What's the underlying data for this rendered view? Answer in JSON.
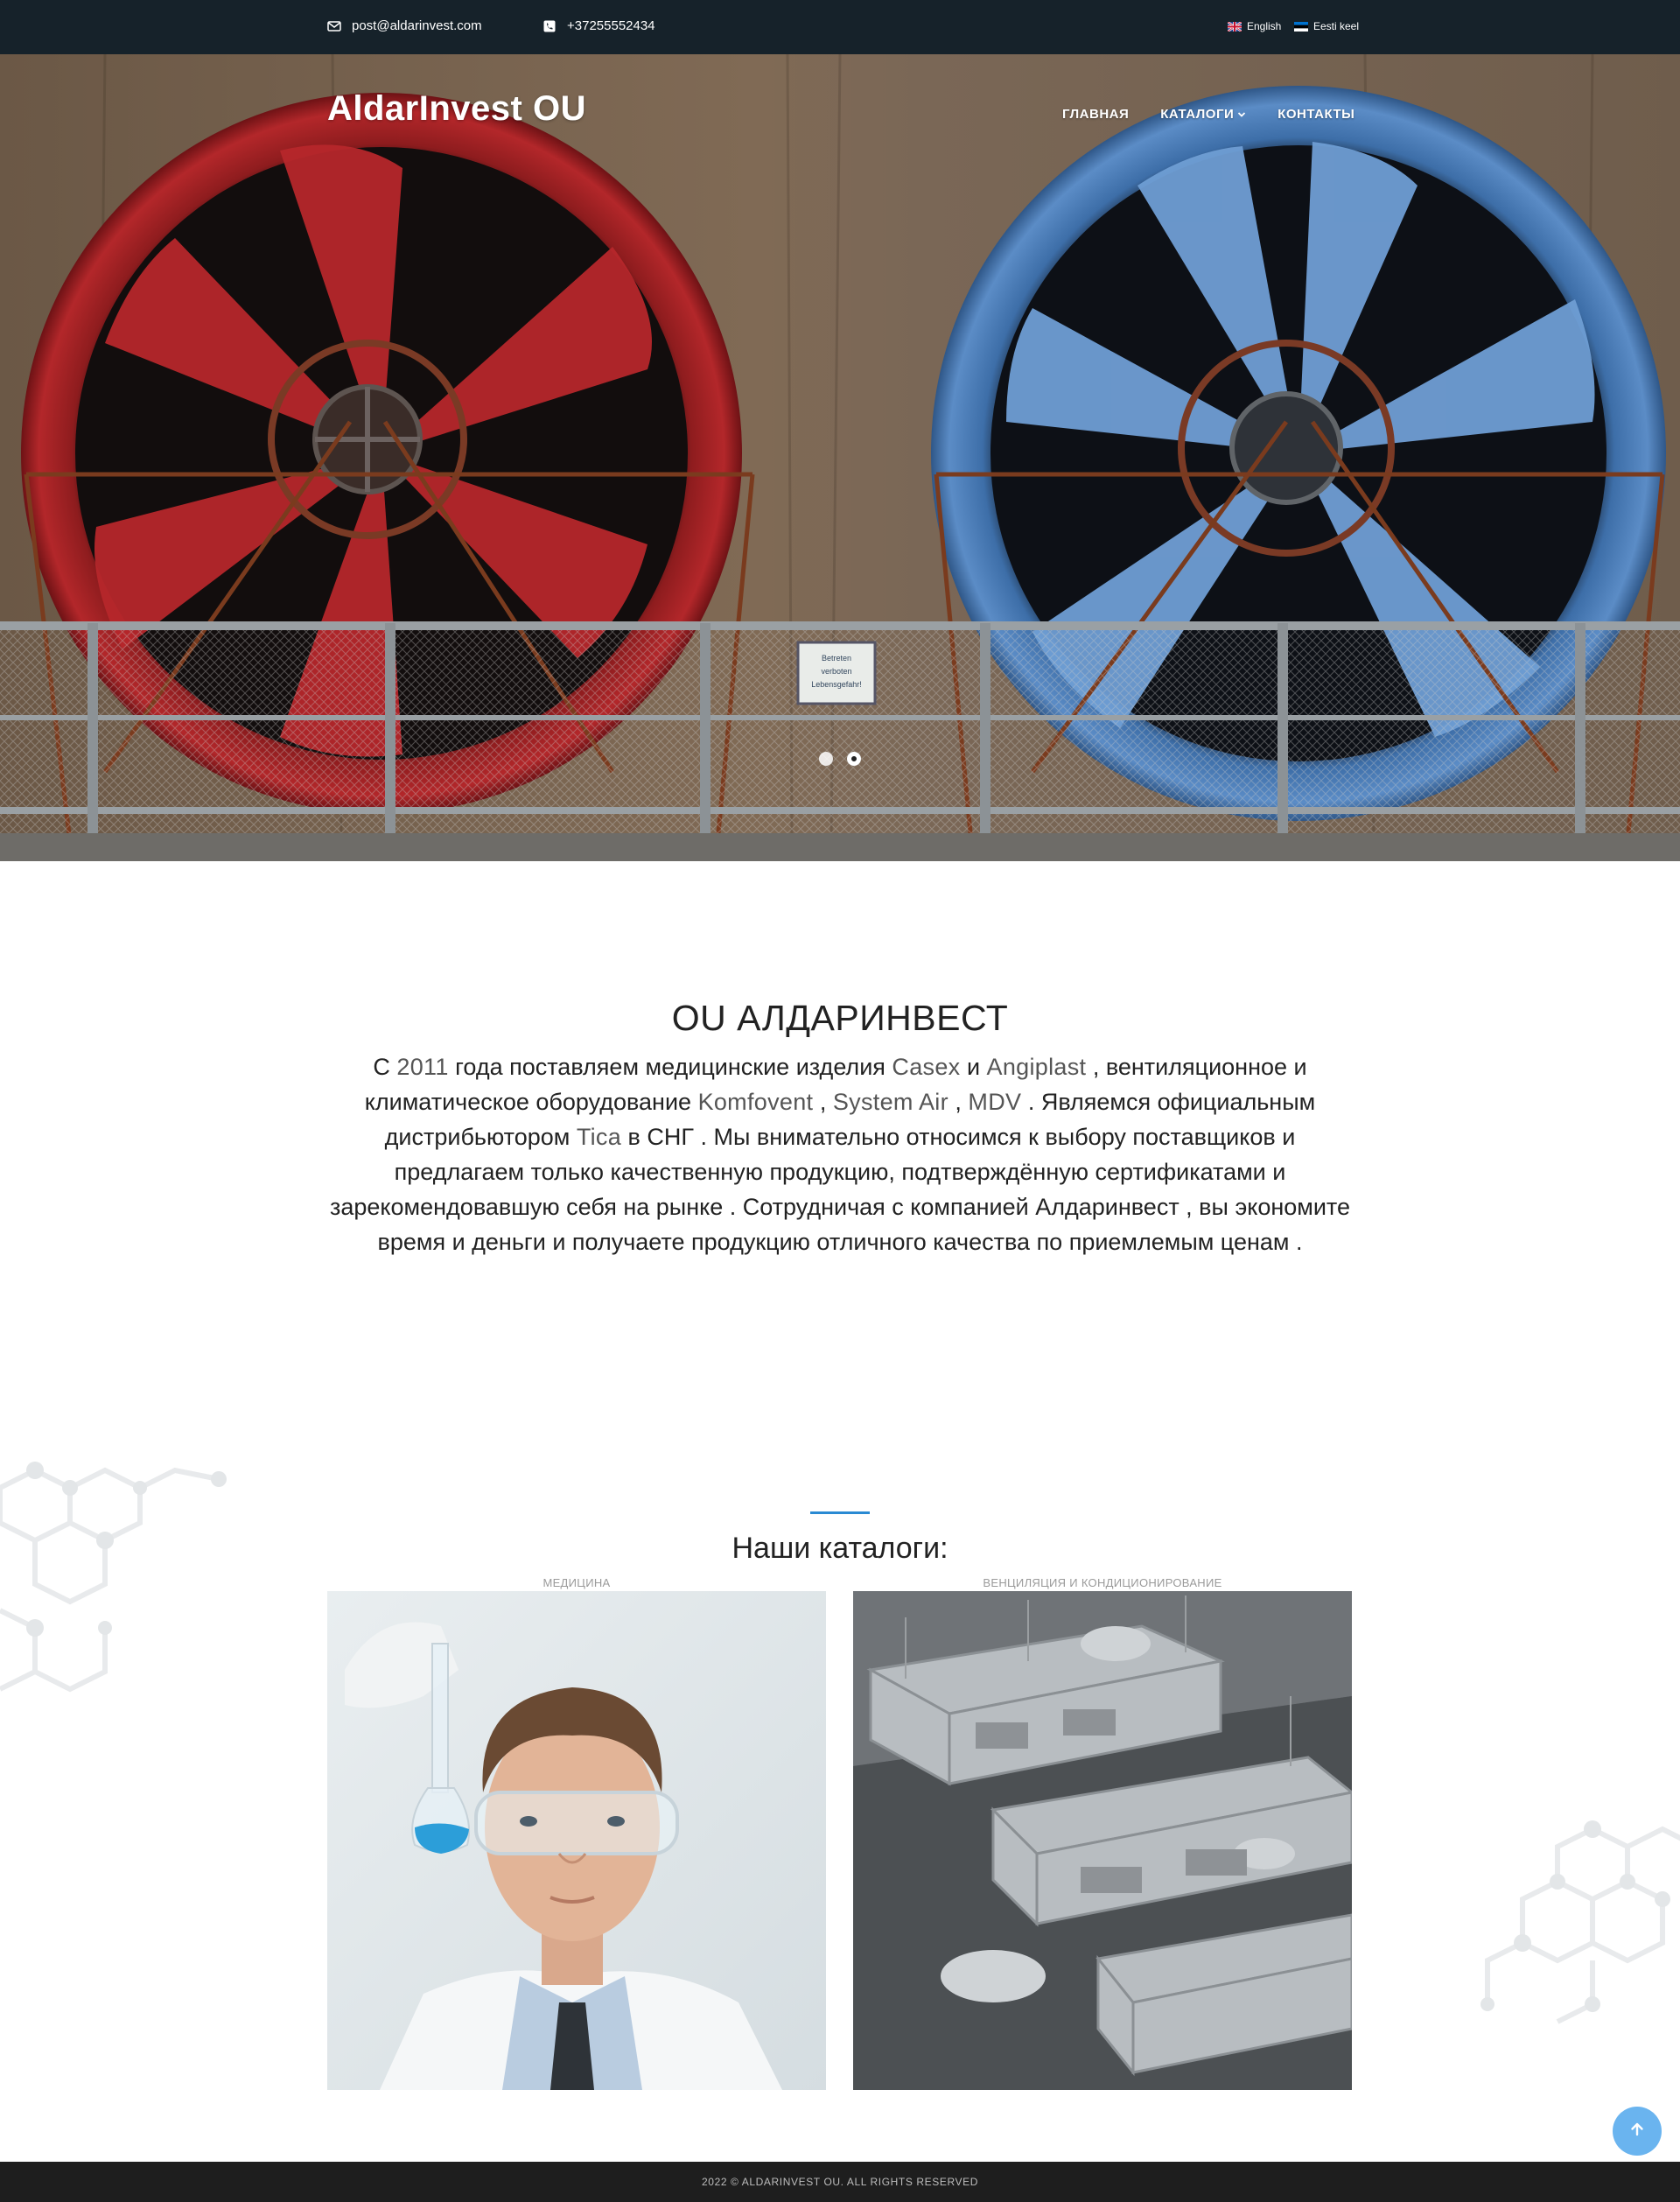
{
  "topbar": {
    "email": "post@aldarinvest.com",
    "phone": "+37255552434",
    "languages": [
      {
        "label": "English",
        "icon": "uk-flag-icon"
      },
      {
        "label": "Eesti keel",
        "icon": "estonia-flag-icon"
      }
    ]
  },
  "header": {
    "brand": "AldarInvest OU",
    "nav": [
      {
        "label": "ГЛАВНАЯ"
      },
      {
        "label": "КАТАЛОГИ",
        "has_dropdown": true
      },
      {
        "label": "КОНТАКТЫ"
      }
    ]
  },
  "hero": {
    "sign": [
      "Betreten",
      "verboten",
      "Lebensgefahr!"
    ],
    "slides": 2,
    "active_slide": 1
  },
  "about": {
    "title": "OU АЛДАРИНВЕСТ",
    "p1": "С ",
    "year": "2011",
    "p2": " года поставляем медицинские изделия ",
    "brand1": "Casex",
    "p3": "  и ",
    "brand2": "Angiplast",
    "p4": " , вентиляционное  и климатическое оборудование ",
    "brand3": "Komfovent",
    "p5": " , ",
    "brand4": "System Air",
    "p6": " ,  ",
    "brand5": "MDV",
    "p7": " . Являемся официальным дистрибьютором ",
    "brand6": "Tica",
    "p8": " в СНГ . Мы внимательно относимся к выбору поставщиков и предлагаем только качественную продукцию, подтверждённую сертификатами и зарекомендовавшую себя на рынке . Сотрудничая с компанией Алдаринвест , вы экономите время и деньги и получаете продукцию отличного качества по приемлемым ценам ."
  },
  "catalogs": {
    "title": "Наши каталоги:",
    "items": [
      {
        "label": "МЕДИЦИНА"
      },
      {
        "label": "ВЕНЦИЛЯЦИЯ И КОНДИЦИОНИРОВАНИЕ"
      }
    ]
  },
  "footer": {
    "text": "2022 © ALDARINVEST OU. ALL RIGHTS RESERVED"
  },
  "colors": {
    "topbar": "#16222a",
    "accent": "#2a8ad3",
    "scroll_button": "#6ab4ef",
    "footer": "#1e1e1e"
  }
}
